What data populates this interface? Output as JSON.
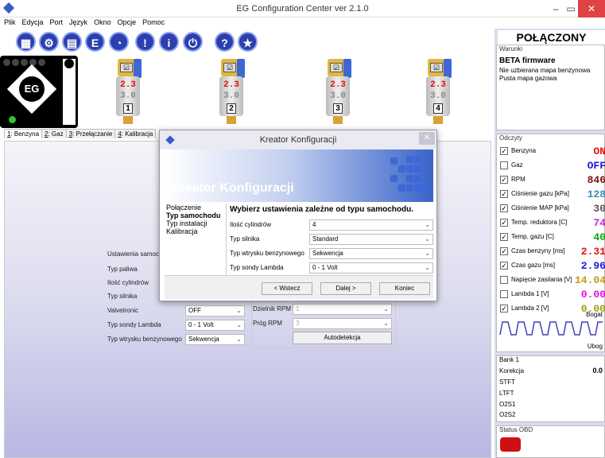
{
  "window": {
    "title": "EG Configuration Center ver 2.1.0",
    "minimize": "–",
    "maximize": "▭",
    "close": "✕"
  },
  "menu": [
    "Plik",
    "Edycja",
    "Port",
    "Język",
    "Okno",
    "Opcje",
    "Pomoc"
  ],
  "toolbar": [
    {
      "icon": "grid-icon",
      "glyph": "▦"
    },
    {
      "icon": "gear-icon",
      "glyph": "⚙"
    },
    {
      "icon": "chip-icon",
      "glyph": "▤"
    },
    {
      "icon": "e-icon",
      "glyph": "E"
    },
    {
      "icon": "gauge-icon",
      "glyph": "◔"
    },
    {
      "icon": "alert-icon",
      "glyph": "!"
    },
    {
      "icon": "info-icon",
      "glyph": "i"
    },
    {
      "icon": "plug-icon",
      "glyph": "⏻"
    },
    {
      "icon": "help-icon",
      "glyph": "?"
    },
    {
      "icon": "star-icon",
      "glyph": "★"
    }
  ],
  "device": {
    "logo": "EG"
  },
  "injectors": [
    {
      "petrol": "2.3",
      "gas": "3.0",
      "number": "1"
    },
    {
      "petrol": "2.3",
      "gas": "3.0",
      "number": "2"
    },
    {
      "petrol": "2.3",
      "gas": "3.0",
      "number": "3"
    },
    {
      "petrol": "2.3",
      "gas": "3.0",
      "number": "4"
    }
  ],
  "tabs": [
    {
      "key": "1",
      "label": ": Benzyna"
    },
    {
      "key": "2",
      "label": ": Gaz"
    },
    {
      "key": "3",
      "label": ": Przełączanie"
    },
    {
      "key": "4",
      "label": ": Kalibracja"
    }
  ],
  "main": {
    "ustawienia_label": "Ustawienia samoch",
    "fields": {
      "typ_paliwa": "Typ paliwa",
      "ilosc_cylindrow": "Ilość cylindrów",
      "typ_silnika": "Typ silnika",
      "valvetronic": "Valvetronic",
      "typ_sondy": "Typ sondy Lambda",
      "typ_wtrysku": "Typ wtrysku benzynowego"
    },
    "values": {
      "valvetronic": "OFF",
      "typ_sondy": "0 - 1 Volt",
      "typ_wtrysku": "Sekwencja"
    },
    "dzielnik_label": "Dzielnik RPM",
    "dzielnik_value": "1",
    "prog_label": "Próg RPM",
    "prog_value": "3",
    "autodetekcja": "Autodetekcja"
  },
  "status": {
    "connection": "POŁĄCZONY",
    "warunki_title": "Warunki",
    "beta": "BETA firmware",
    "line1": "Nie uzbierana mapa benzynowa",
    "line2": "Pusta mapa gazowa"
  },
  "odczyty": {
    "title": "Odczyty",
    "rows": [
      {
        "label": "Benzyna",
        "value": "ON",
        "checked": true,
        "color": "#e01010"
      },
      {
        "label": "Gaz",
        "value": "OFF",
        "checked": false,
        "color": "#1a1ad0"
      },
      {
        "label": "RPM",
        "value": "846",
        "checked": true,
        "color": "#7a1010"
      },
      {
        "label": "Ciśnienie gazu [kPa]",
        "value": "128",
        "checked": true,
        "color": "#3e8cb0"
      },
      {
        "label": "Ciśnienie MAP [kPa]",
        "value": "30",
        "checked": true,
        "color": "#555555"
      },
      {
        "label": "Temp. reduktora [C]",
        "value": "74",
        "checked": true,
        "color": "#c02ad0"
      },
      {
        "label": "Temp. gazu [C]",
        "value": "40",
        "checked": true,
        "color": "#10a010"
      },
      {
        "label": "Czas benzyny [ms]",
        "value": "2.31",
        "checked": true,
        "color": "#e01010"
      },
      {
        "label": "Czas gazu [ms]",
        "value": "2.96",
        "checked": true,
        "color": "#1a1ad0"
      },
      {
        "label": "Napięcie zasilania [V]",
        "value": "14.04",
        "checked": false,
        "color": "#c89a10"
      },
      {
        "label": "Lambda 1 [V]",
        "value": "0.00",
        "checked": false,
        "color": "#e010e0"
      },
      {
        "label": "Lambda 2 [V]",
        "value": "0.00",
        "checked": true,
        "color": "#a0a010"
      }
    ],
    "bogata": "Bogat",
    "uboga": "Ubog"
  },
  "bank": {
    "title": "Bank 1",
    "korekcja": "Korekcja",
    "korekcja_value": "0.0",
    "stft": "STFT",
    "ltft": "LTFT",
    "o2s1": "O2S1",
    "o2s2": "O2S2"
  },
  "obd": {
    "title": "Status OBD"
  },
  "dialog": {
    "title": "Kreator Konfiguracji",
    "banner": "Kreator Konfiguracji",
    "close": "✕",
    "nav": [
      "Połączenie",
      "Typ samochodu",
      "Typ instalacji",
      "Kalibracja"
    ],
    "heading": "Wybierz ustawienia zależne od typu samochodu.",
    "fields": [
      {
        "label": "Ilość cylindrów",
        "value": "4"
      },
      {
        "label": "Typ silnika",
        "value": "Standard"
      },
      {
        "label": "Typ wtrysku benzynowego",
        "value": "Sekwencja"
      },
      {
        "label": "Typ sondy Lambda",
        "value": "0 - 1 Volt"
      }
    ],
    "back": "< Wstecz",
    "next": "Dalej >",
    "finish": "Koniec"
  }
}
